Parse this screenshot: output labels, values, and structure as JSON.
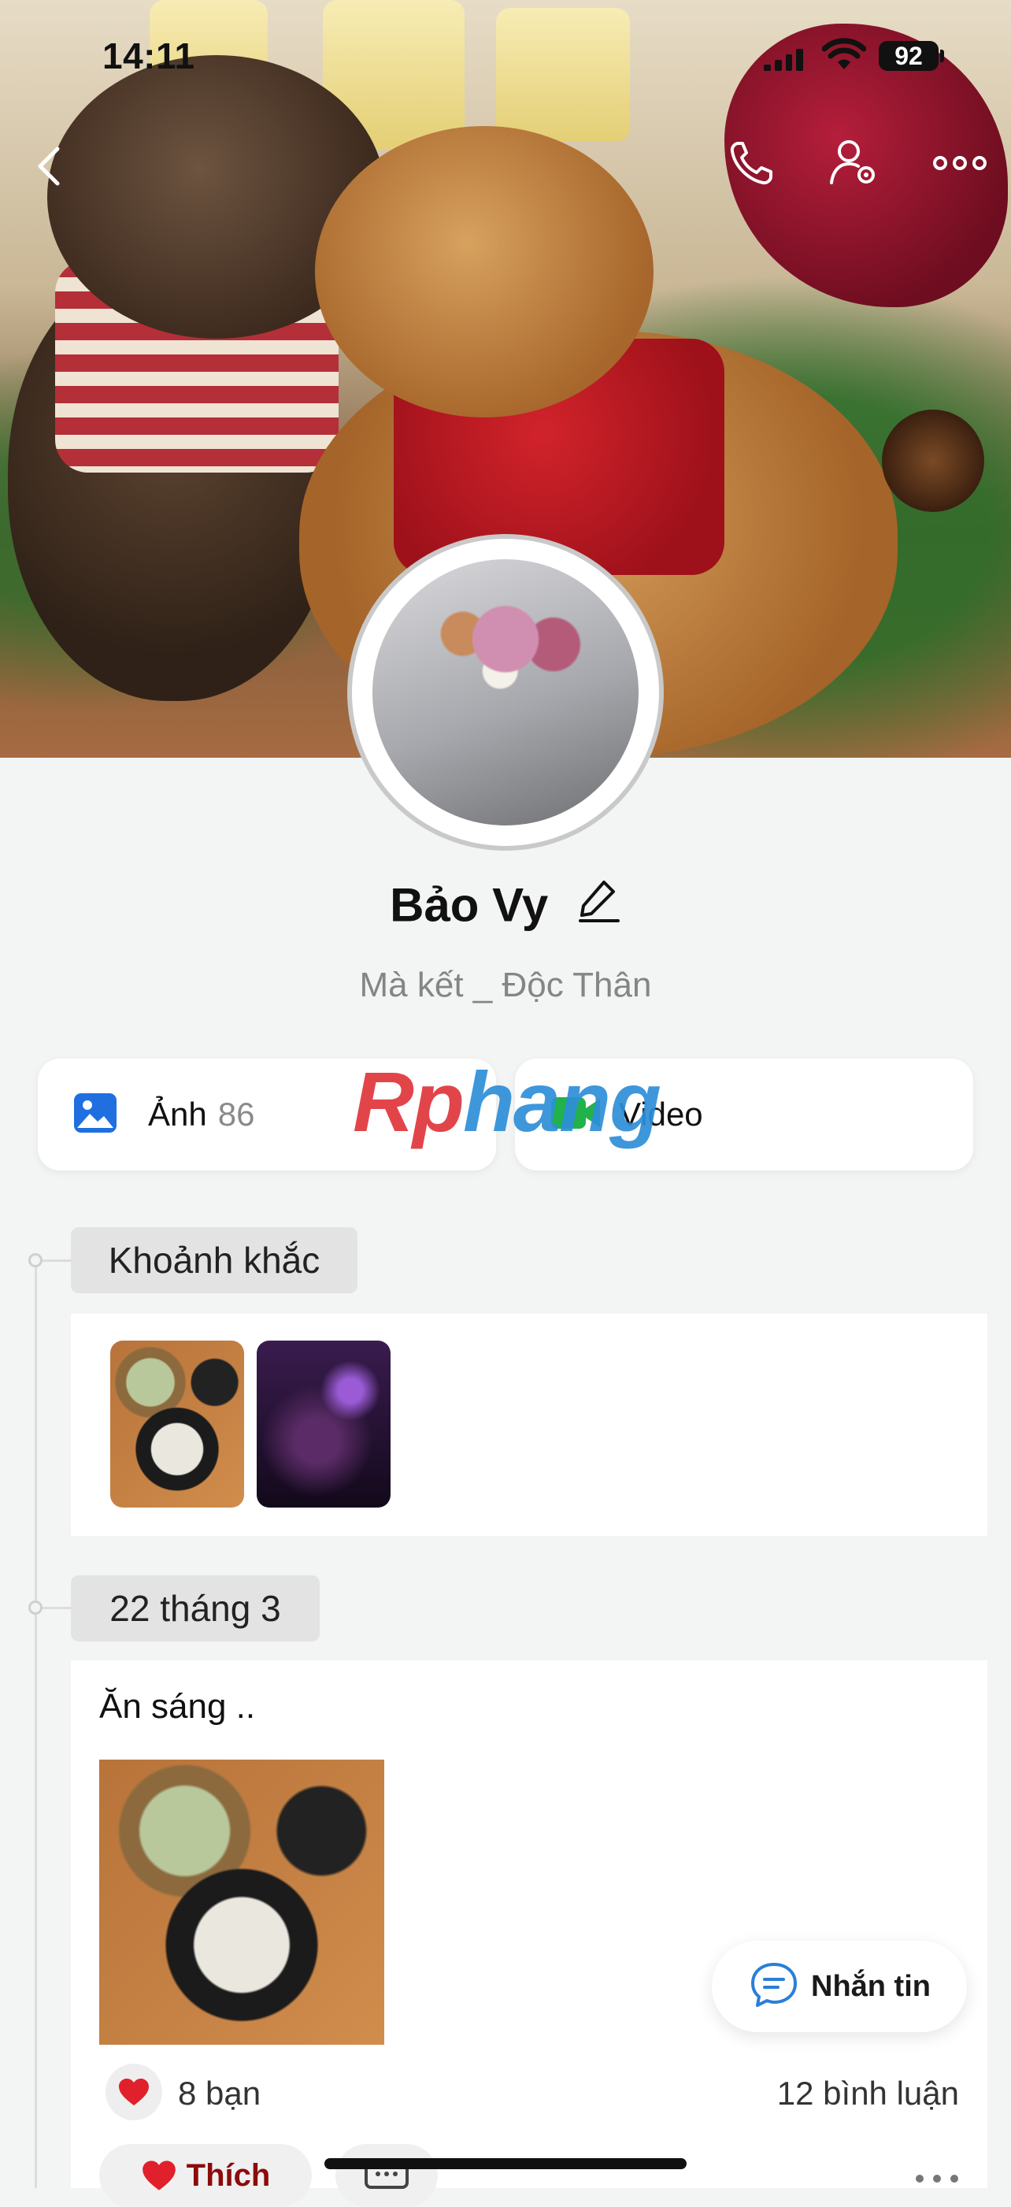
{
  "status_bar": {
    "time": "14:11",
    "battery": "92"
  },
  "top_bar": {
    "back_icon": "chevron-left-icon",
    "call_icon": "phone-icon",
    "settings_icon": "user-settings-icon",
    "more_icon": "more-icon"
  },
  "profile": {
    "name": "Bảo Vy",
    "bio": "Mà kết _ Độc Thân"
  },
  "media_cards": [
    {
      "label": "Ảnh",
      "count": "86",
      "icon": "photo-icon",
      "color": "#1f6fe0"
    },
    {
      "label": "Video",
      "icon": "video-camera-icon",
      "color": "#22b24c"
    }
  ],
  "watermark": "Rphang",
  "moments": {
    "title": "Khoảnh khắc"
  },
  "post": {
    "date": "22 tháng 3",
    "text": "Ăn sáng ..",
    "reactions": "8 bạn",
    "comments": "12 bình luận",
    "like_label": "Thích"
  },
  "message_button": {
    "label": "Nhắn tin"
  },
  "colors": {
    "like": "#e0202a",
    "message_icon": "#2a7fd8"
  }
}
